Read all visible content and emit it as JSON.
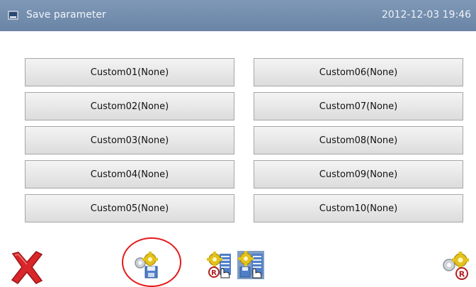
{
  "titlebar": {
    "title": "Save parameter",
    "datetime": "2012-12-03  19:46"
  },
  "custom_slots": [
    {
      "label": "Custom01(None)"
    },
    {
      "label": "Custom02(None)"
    },
    {
      "label": "Custom03(None)"
    },
    {
      "label": "Custom04(None)"
    },
    {
      "label": "Custom05(None)"
    },
    {
      "label": "Custom06(None)"
    },
    {
      "label": "Custom07(None)"
    },
    {
      "label": "Custom08(None)"
    },
    {
      "label": "Custom09(None)"
    },
    {
      "label": "Custom10(None)"
    }
  ],
  "toolbar": {
    "icons": [
      "close-icon",
      "save-gear-disk-icon",
      "load-gear-hand-icon",
      "save-gear-hand-icon",
      "restore-gear-icon"
    ],
    "highlighted": "save-gear-disk-icon"
  },
  "colors": {
    "titlebar": "#7390b2",
    "close_red": "#d8262a",
    "gear_yellow": "#e3c21b",
    "disk_blue": "#4f7fc8",
    "highlight_circle": "#e51a1a",
    "selected_tool_bg": "#7f9ec4"
  }
}
